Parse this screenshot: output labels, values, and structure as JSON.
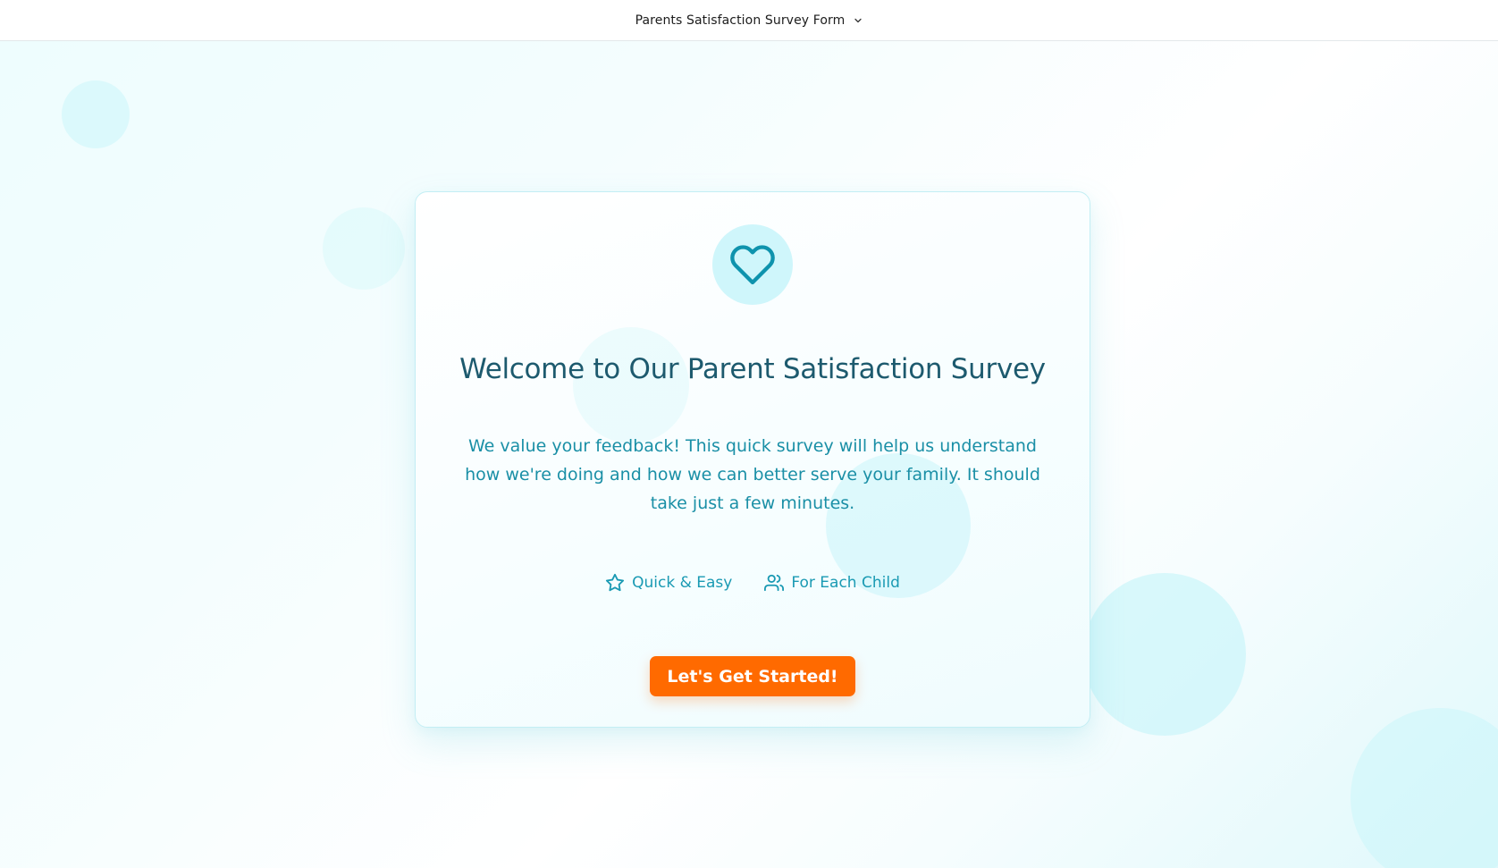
{
  "header": {
    "form_title": "Parents Satisfaction Survey Form",
    "switcher_icon": "chevron-down-icon"
  },
  "welcome": {
    "icon": "heart-icon",
    "title": "Welcome to Our Parent Satisfaction Survey",
    "description": "We value your feedback! This quick survey will help us understand how we're doing and how we can better serve your family. It should take just a few minutes.",
    "features": [
      {
        "icon": "star-icon",
        "label": "Quick & Easy"
      },
      {
        "icon": "users-icon",
        "label": "For Each Child"
      }
    ],
    "cta_label": "Let's Get Started!"
  },
  "colors": {
    "accent": "#0e93ad",
    "title": "#1d5a6e",
    "cta": "#ff6a00",
    "icon_bg": "#cff6fb"
  }
}
